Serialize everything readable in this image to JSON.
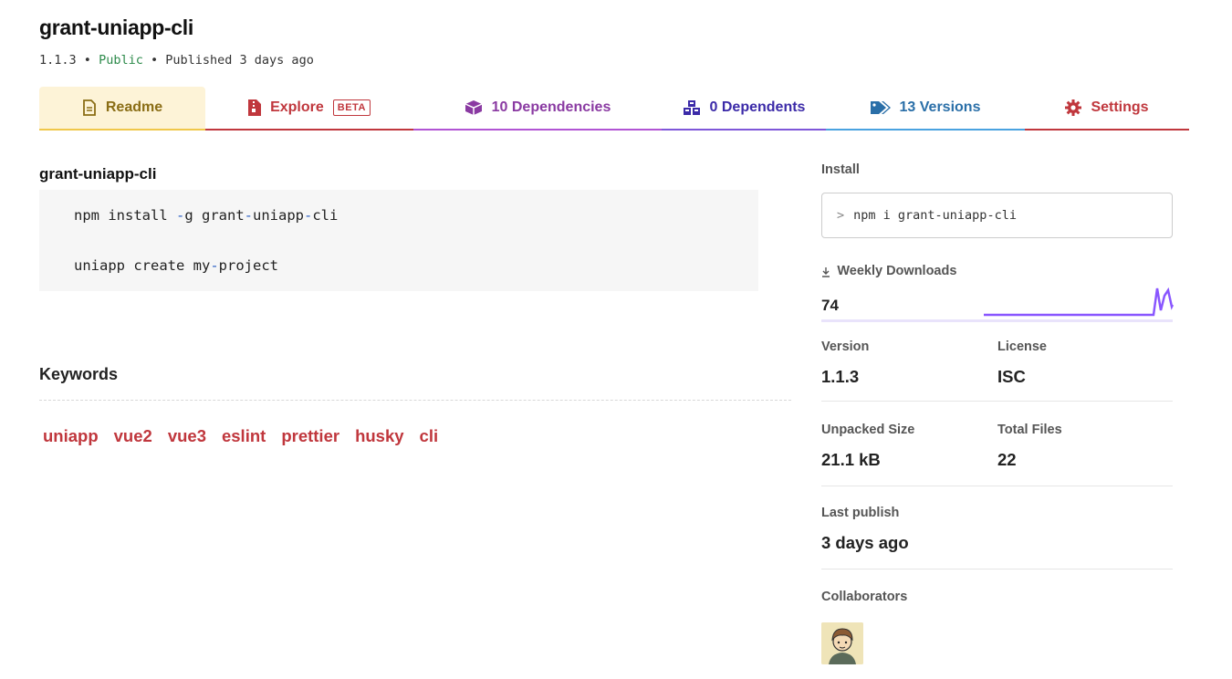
{
  "package": {
    "name": "grant-uniapp-cli",
    "version": "1.1.3",
    "sep1": "•",
    "visibility": "Public",
    "sep2": "•",
    "published": "Published 3 days ago"
  },
  "tabs": {
    "readme": "Readme",
    "explore": "Explore",
    "explore_badge": "BETA",
    "dependencies": "10 Dependencies",
    "dependents": "0 Dependents",
    "versions": "13 Versions",
    "settings": "Settings"
  },
  "readme": {
    "heading": "grant-uniapp-cli",
    "code": {
      "line1_a": "npm install ",
      "line1_b": "-",
      "line1_c": "g grant",
      "line1_d": "-",
      "line1_e": "uniapp",
      "line1_f": "-",
      "line1_g": "cli",
      "line2_a": "uniapp create my",
      "line2_b": "-",
      "line2_c": "project"
    }
  },
  "keywords": {
    "heading": "Keywords",
    "items": [
      "uniapp",
      "vue2",
      "vue3",
      "eslint",
      "prettier",
      "husky",
      "cli"
    ]
  },
  "sidebar": {
    "install_label": "Install",
    "install_prompt": ">",
    "install_command": "npm i grant-uniapp-cli",
    "downloads_label": "Weekly Downloads",
    "downloads_icon": "download-icon",
    "downloads_value": "74",
    "version_label": "Version",
    "version_value": "1.1.3",
    "license_label": "License",
    "license_value": "ISC",
    "unpacked_label": "Unpacked Size",
    "unpacked_value": "21.1 kB",
    "files_label": "Total Files",
    "files_value": "22",
    "last_publish_label": "Last publish",
    "last_publish_value": "3 days ago",
    "collaborators_label": "Collaborators"
  },
  "colors": {
    "accent_red": "#c0373d",
    "public_green": "#2c8a4a",
    "sparkline": "#8956ff"
  }
}
